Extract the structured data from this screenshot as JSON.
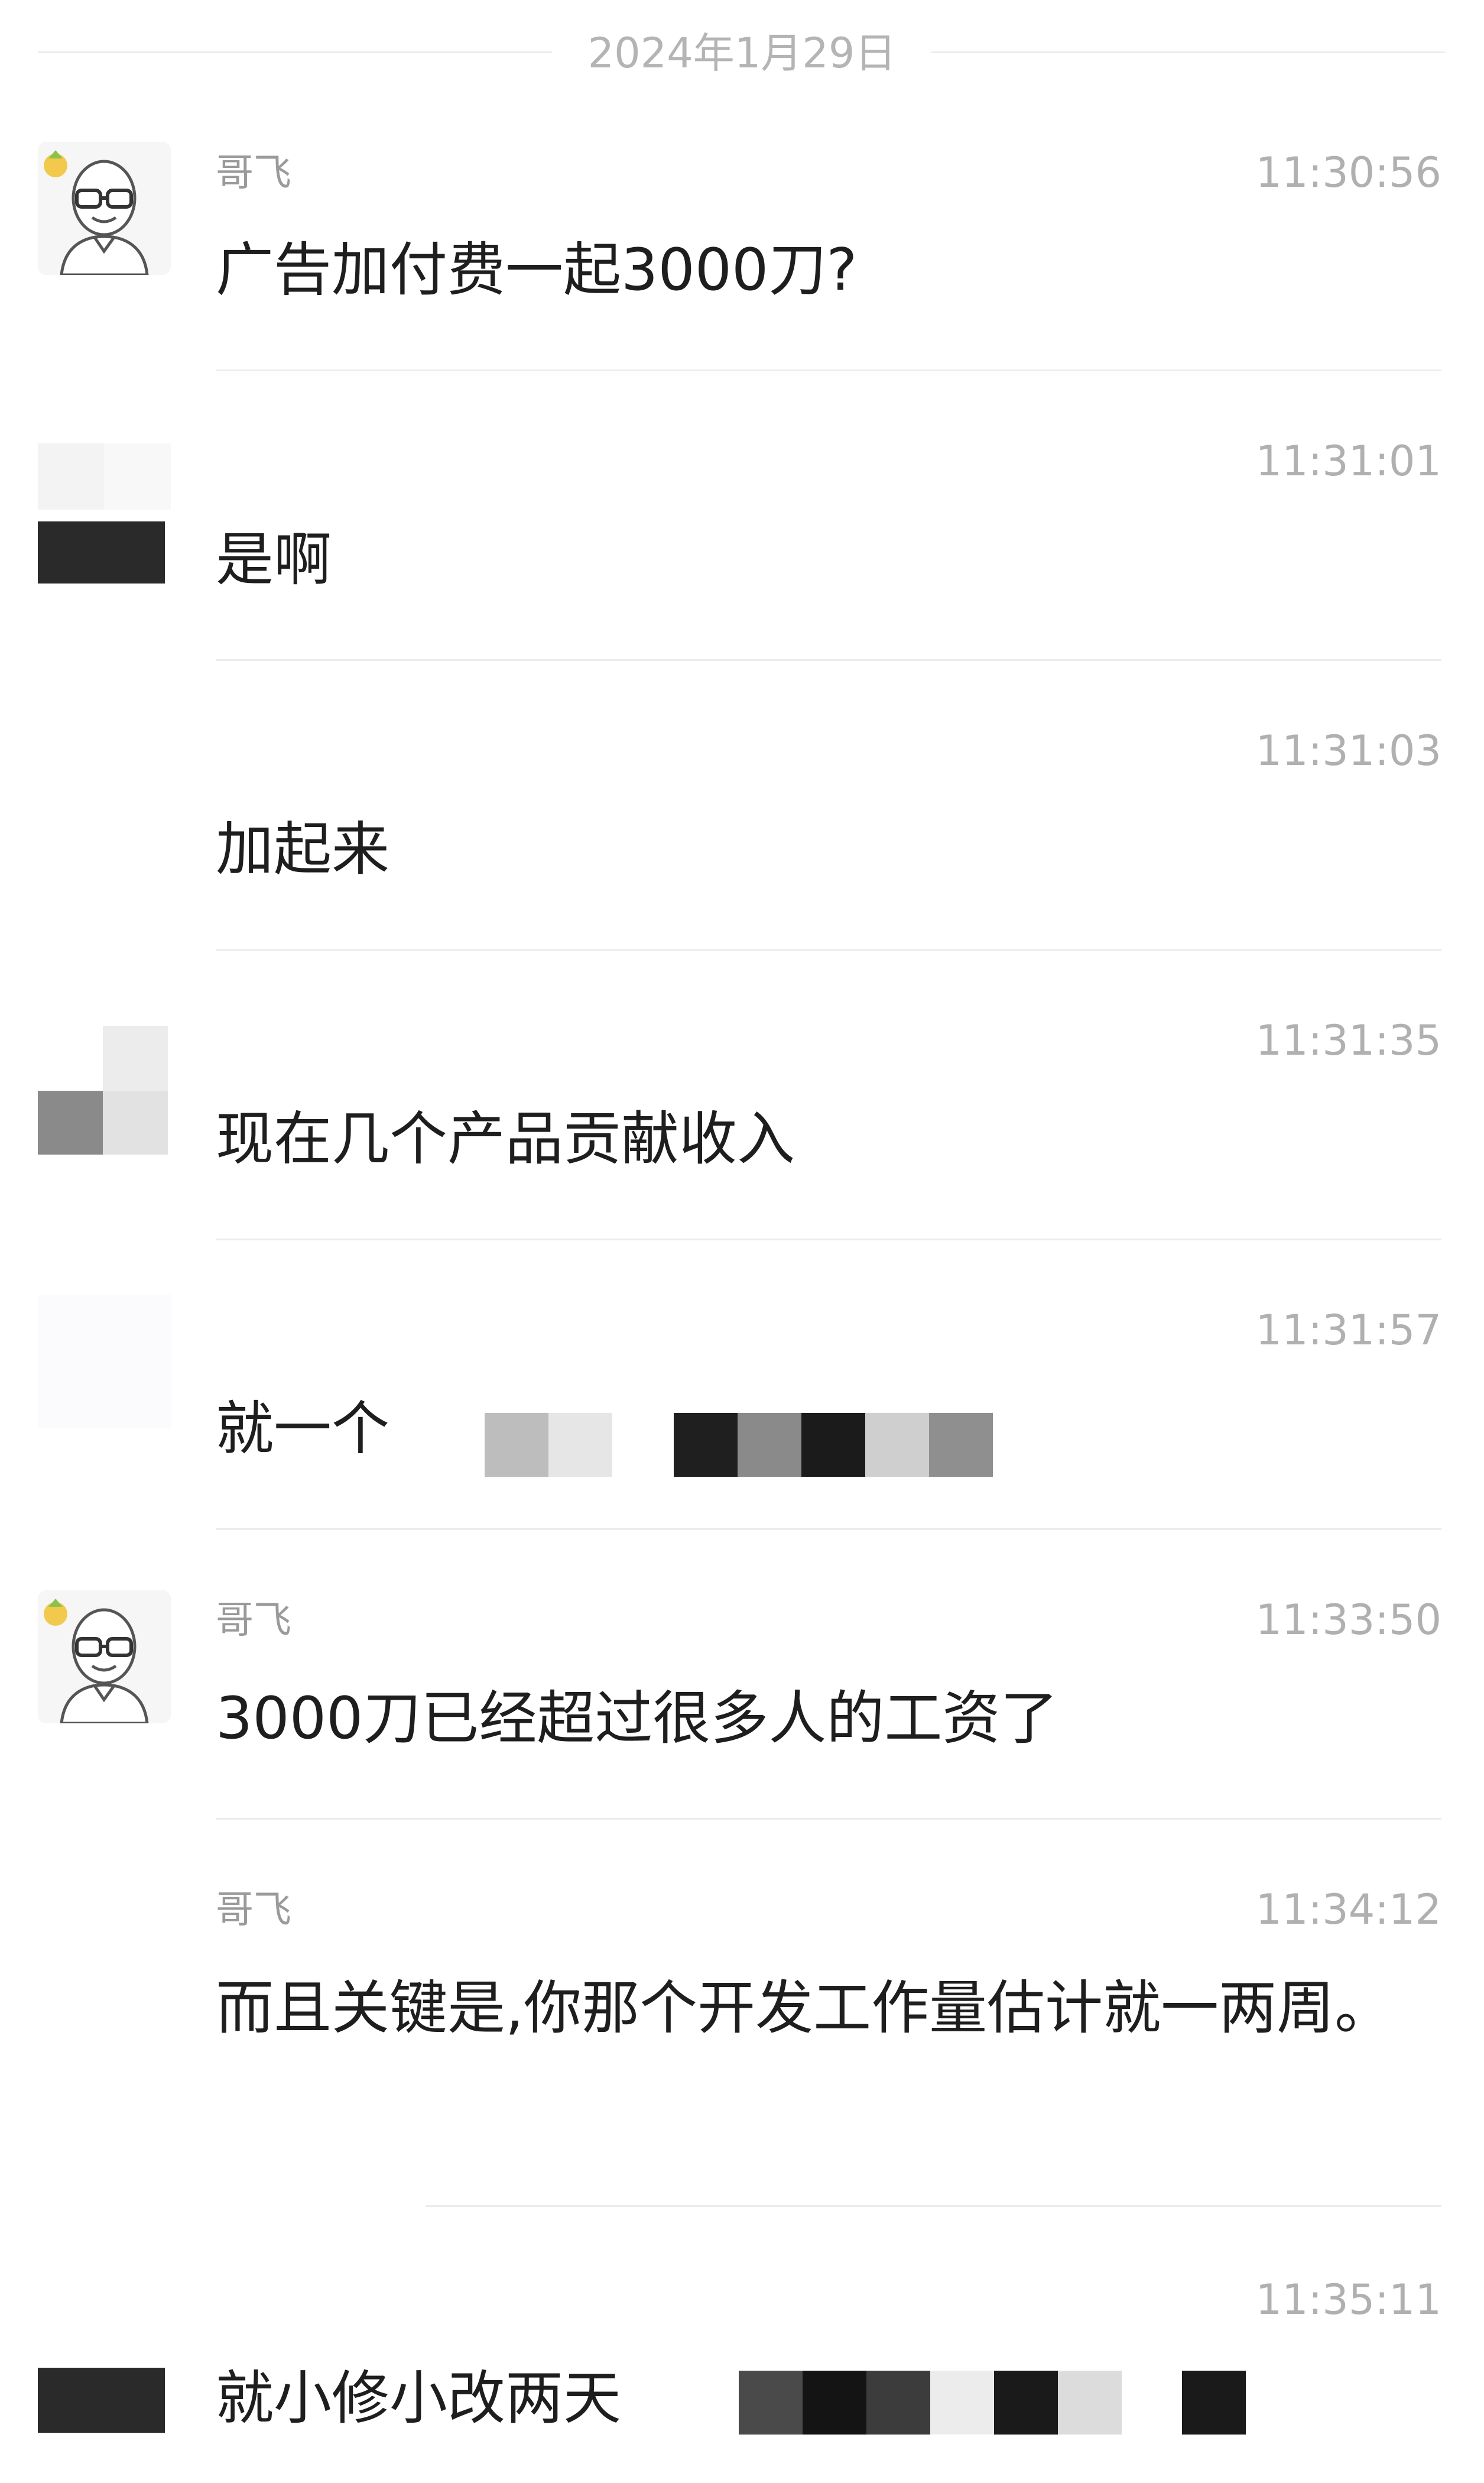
{
  "date_separator": "2024年1月29日",
  "colors": {
    "background": "#ffffff",
    "message_text": "#1e1e1e",
    "meta_text": "#b0b0b0",
    "divider": "#ececec"
  },
  "messages": [
    {
      "sender": "哥飞",
      "time": "11:30:56",
      "text": "广告加付费一起3000刀?",
      "avatar": "cartoon-bald-man-with-glasses"
    },
    {
      "sender": "",
      "time": "11:31:01",
      "text": "是啊",
      "avatar": "pixelated"
    },
    {
      "sender": "",
      "time": "11:31:03",
      "text": "加起来",
      "avatar": "none"
    },
    {
      "sender": "",
      "time": "11:31:35",
      "text": "现在几个产品贡献收入",
      "avatar": "pixelated"
    },
    {
      "sender": "",
      "time": "11:31:57",
      "text": "就一个",
      "avatar": "pixelated",
      "redacted_after_text": true
    },
    {
      "sender": "哥飞",
      "time": "11:33:50",
      "text": "3000刀已经超过很多人的工资了",
      "avatar": "cartoon-bald-man-with-glasses"
    },
    {
      "sender": "哥飞",
      "time": "11:34:12",
      "text": "而且关键是,你那个开发工作量估计就一两周。",
      "avatar": "none"
    },
    {
      "sender": "",
      "time": "11:35:11",
      "text": "就小修小改两天",
      "avatar": "pixelated",
      "redacted_after_text": true
    }
  ]
}
